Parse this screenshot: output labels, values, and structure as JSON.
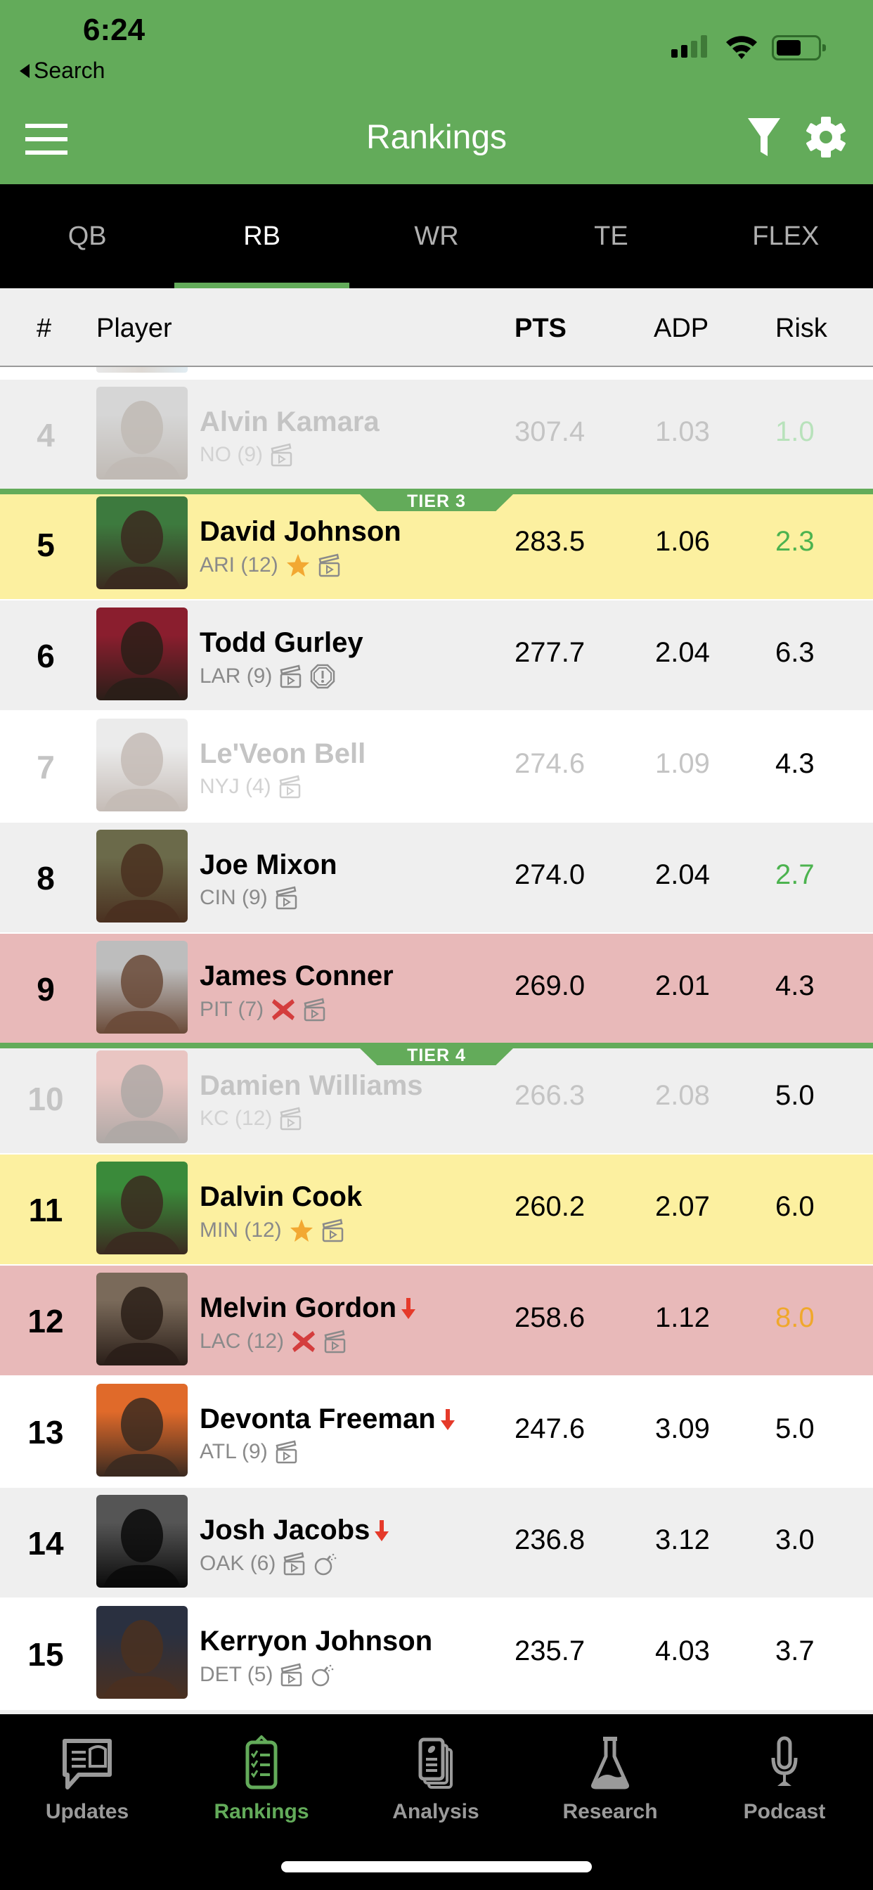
{
  "status_bar": {
    "time": "6:24",
    "back_label": "Search"
  },
  "nav": {
    "title": "Rankings"
  },
  "colors": {
    "brand_green": "#63ab5a",
    "row_yellow": "#fcf0a0",
    "row_red": "#e8b9b9",
    "row_gray": "#efefef",
    "risk_green": "#4cb34f",
    "risk_orange": "#f0a82c",
    "arrow_red": "#e53a2a"
  },
  "tabs": [
    {
      "label": "QB",
      "active": false
    },
    {
      "label": "RB",
      "active": true
    },
    {
      "label": "WR",
      "active": false
    },
    {
      "label": "TE",
      "active": false
    },
    {
      "label": "FLEX",
      "active": false
    }
  ],
  "columns": {
    "rank": "#",
    "player": "Player",
    "pts": "PTS",
    "adp": "ADP",
    "risk": "Risk"
  },
  "tiers": [
    {
      "label": "TIER 3"
    },
    {
      "label": "TIER 4"
    }
  ],
  "players": [
    {
      "rank": "4",
      "name": "Alvin Kamara",
      "team": "NO (9)",
      "pts": "307.4",
      "adp": "1.03",
      "risk": "1.0",
      "risk_color": "green",
      "highlight": "gray",
      "faded": true,
      "icons": [
        "video"
      ],
      "trend": ""
    },
    {
      "rank": "5",
      "name": "David Johnson",
      "team": "ARI (12)",
      "pts": "283.5",
      "adp": "1.06",
      "risk": "2.3",
      "risk_color": "green",
      "highlight": "yellow",
      "faded": false,
      "icons": [
        "star",
        "video"
      ],
      "trend": ""
    },
    {
      "rank": "6",
      "name": "Todd Gurley",
      "team": "LAR (9)",
      "pts": "277.7",
      "adp": "2.04",
      "risk": "6.3",
      "risk_color": "black",
      "highlight": "gray",
      "faded": false,
      "icons": [
        "video",
        "injury-alert"
      ],
      "trend": ""
    },
    {
      "rank": "7",
      "name": "Le'Veon Bell",
      "team": "NYJ (4)",
      "pts": "274.6",
      "adp": "1.09",
      "risk": "4.3",
      "risk_color": "black",
      "highlight": "white",
      "faded": true,
      "icons": [
        "video"
      ],
      "trend": ""
    },
    {
      "rank": "8",
      "name": "Joe Mixon",
      "team": "CIN (9)",
      "pts": "274.0",
      "adp": "2.04",
      "risk": "2.7",
      "risk_color": "green",
      "highlight": "gray",
      "faded": false,
      "icons": [
        "video"
      ],
      "trend": ""
    },
    {
      "rank": "9",
      "name": "James Conner",
      "team": "PIT (7)",
      "pts": "269.0",
      "adp": "2.01",
      "risk": "4.3",
      "risk_color": "black",
      "highlight": "red",
      "faded": false,
      "icons": [
        "avoid",
        "video"
      ],
      "trend": ""
    },
    {
      "rank": "10",
      "name": "Damien Williams",
      "team": "KC (12)",
      "pts": "266.3",
      "adp": "2.08",
      "risk": "5.0",
      "risk_color": "black",
      "highlight": "gray",
      "faded": true,
      "icons": [
        "video"
      ],
      "trend": ""
    },
    {
      "rank": "11",
      "name": "Dalvin Cook",
      "team": "MIN (12)",
      "pts": "260.2",
      "adp": "2.07",
      "risk": "6.0",
      "risk_color": "black",
      "highlight": "yellow",
      "faded": false,
      "icons": [
        "star",
        "video"
      ],
      "trend": ""
    },
    {
      "rank": "12",
      "name": "Melvin Gordon",
      "team": "LAC (12)",
      "pts": "258.6",
      "adp": "1.12",
      "risk": "8.0",
      "risk_color": "orange",
      "highlight": "red",
      "faded": false,
      "icons": [
        "avoid",
        "video"
      ],
      "trend": "down"
    },
    {
      "rank": "13",
      "name": "Devonta Freeman",
      "team": "ATL (9)",
      "pts": "247.6",
      "adp": "3.09",
      "risk": "5.0",
      "risk_color": "black",
      "highlight": "white",
      "faded": false,
      "icons": [
        "video"
      ],
      "trend": "down"
    },
    {
      "rank": "14",
      "name": "Josh Jacobs",
      "team": "OAK (6)",
      "pts": "236.8",
      "adp": "3.12",
      "risk": "3.0",
      "risk_color": "black",
      "highlight": "gray",
      "faded": false,
      "icons": [
        "video",
        "rookie-bomb"
      ],
      "trend": "down"
    },
    {
      "rank": "15",
      "name": "Kerryon Johnson",
      "team": "DET (5)",
      "pts": "235.7",
      "adp": "4.03",
      "risk": "3.7",
      "risk_color": "black",
      "highlight": "white",
      "faded": false,
      "icons": [
        "video",
        "rookie-bomb"
      ],
      "trend": ""
    }
  ],
  "bottom_nav": [
    {
      "label": "Updates",
      "icon": "updates-icon",
      "active": false
    },
    {
      "label": "Rankings",
      "icon": "rankings-icon",
      "active": true
    },
    {
      "label": "Analysis",
      "icon": "analysis-icon",
      "active": false
    },
    {
      "label": "Research",
      "icon": "research-icon",
      "active": false
    },
    {
      "label": "Podcast",
      "icon": "podcast-icon",
      "active": false
    }
  ]
}
